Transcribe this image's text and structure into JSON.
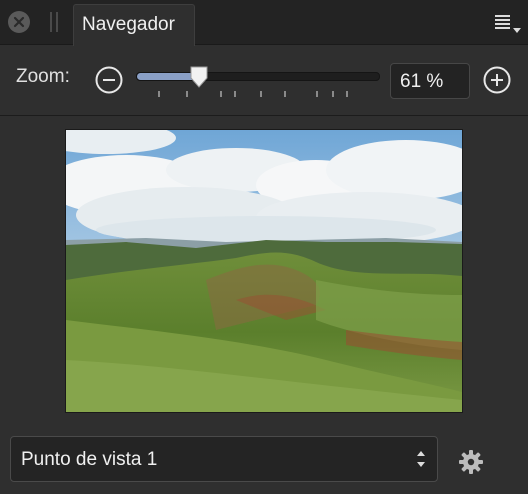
{
  "panel": {
    "tab_label": "Navegador",
    "close_icon": "close-icon",
    "menu_icon": "panel-menu-icon"
  },
  "zoom": {
    "label": "Zoom:",
    "value_text": "61 %",
    "slider_level": 0.26,
    "zoom_out_icon": "minus-circle-icon",
    "zoom_in_icon": "plus-circle-icon",
    "accent_color": "#8aa0c6"
  },
  "preview": {
    "image": "landscape-thumbnail"
  },
  "viewpoint": {
    "selected": "Punto de vista 1",
    "settings_icon": "gear-icon"
  }
}
